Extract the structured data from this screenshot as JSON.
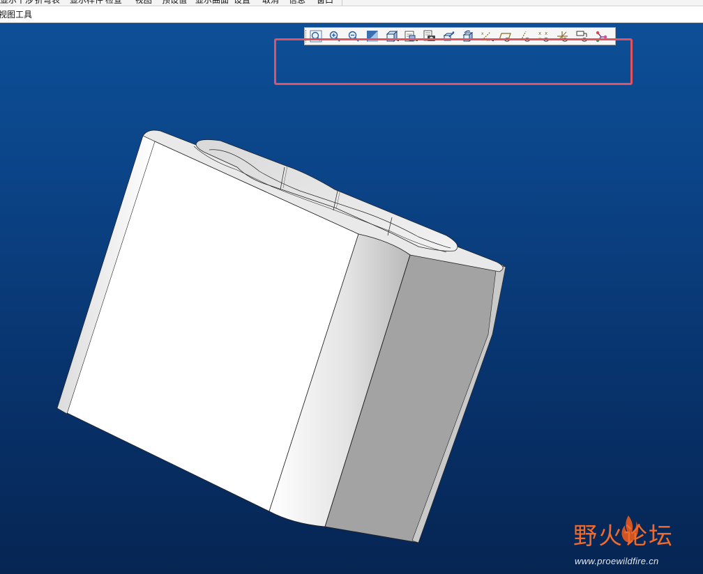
{
  "top_menu": {
    "items": [
      "显示干涉",
      "折弯表",
      "显示样件",
      "检查",
      "视图",
      "预设值",
      "显示曲面",
      "设置",
      "取消",
      "信息",
      "窗口"
    ]
  },
  "toolbar_label": "视图工具",
  "view_toolbar": {
    "buttons": [
      {
        "name": "refit",
        "icon": "refit-icon"
      },
      {
        "name": "zoom-in",
        "icon": "zoom-in-icon"
      },
      {
        "name": "zoom-out",
        "icon": "zoom-out-icon"
      },
      {
        "name": "repaint",
        "icon": "repaint-icon"
      },
      {
        "name": "shading",
        "icon": "shading-icon"
      },
      {
        "name": "saved-views",
        "icon": "saved-views-icon"
      },
      {
        "name": "view-manager",
        "icon": "view-manager-icon"
      },
      {
        "name": "orient-mode",
        "icon": "orient-mode-icon"
      },
      {
        "name": "spin-center",
        "icon": "spin-center-icon"
      },
      {
        "name": "datum-display-filter",
        "icon": "datum-display-filter-icon"
      },
      {
        "name": "plane-display",
        "icon": "plane-display-icon"
      },
      {
        "name": "axis-display",
        "icon": "axis-display-icon"
      },
      {
        "name": "point-display",
        "icon": "point-display-icon"
      },
      {
        "name": "csys-display",
        "icon": "csys-display-icon"
      },
      {
        "name": "annotation-display",
        "icon": "annotation-display-icon"
      },
      {
        "name": "branch-tool",
        "icon": "branch-tool-icon"
      }
    ]
  },
  "watermark": {
    "title": "野火论坛",
    "url": "www.proewildfire.cn"
  },
  "colors": {
    "highlight_box": "#e2535f",
    "viewport_top": "#0d4f97",
    "viewport_bottom": "#062553",
    "model_front": "#ffffff",
    "model_side": "#a3a3a3",
    "watermark": "#ef6a2b"
  }
}
